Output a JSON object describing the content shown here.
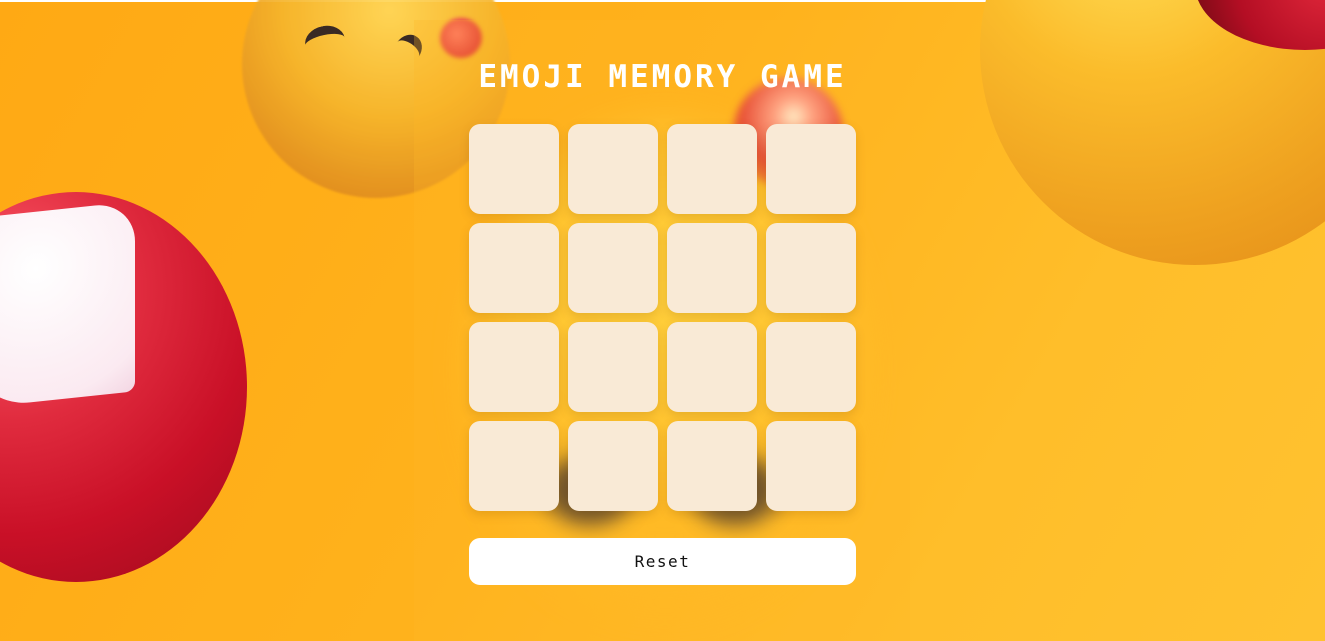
{
  "game": {
    "title": "EMOJI MEMORY GAME",
    "reset_label": "Reset",
    "rows": 4,
    "columns": 4,
    "cards_face_down": 16
  },
  "colors": {
    "background": "#ffb21c",
    "card_back": "#f9ead6",
    "title_text": "#ffffff",
    "button_background": "#ffffff",
    "button_text": "#111111"
  },
  "icons": [
    "kissing-face-emoji-icon",
    "heart-icon",
    "smiling-face-emoji-icon"
  ]
}
